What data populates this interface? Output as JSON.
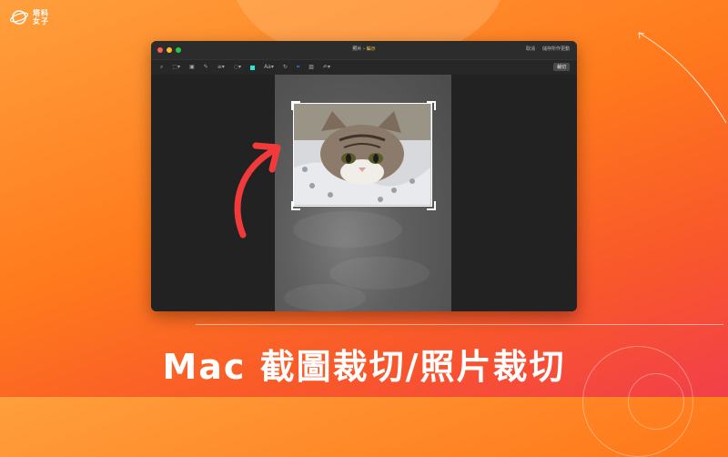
{
  "brand": {
    "line1": "塔科",
    "line2": "女子"
  },
  "window": {
    "title_main": "照片",
    "title_sep": " › ",
    "title_sub": "編示",
    "cancel_label": "取消",
    "save_label": "儲存所作更動",
    "crop_button_label": "裁切",
    "toolbar": [
      {
        "name": "magnifier-icon",
        "glyph": "⌕"
      },
      {
        "name": "shape-select-icon",
        "glyph": "⬚▾"
      },
      {
        "name": "crop-rect-icon",
        "glyph": "▣"
      },
      {
        "name": "pen-icon",
        "glyph": "✎"
      },
      {
        "name": "line-style-icon",
        "glyph": "≡▾"
      },
      {
        "name": "border-style-icon",
        "glyph": "◌▾"
      },
      {
        "name": "font-icon",
        "glyph": "Aa▾"
      },
      {
        "name": "rotate-icon",
        "glyph": "↻"
      },
      {
        "name": "crop-tool-icon",
        "glyph": "⌗"
      },
      {
        "name": "markup-icon",
        "glyph": "▨"
      },
      {
        "name": "sign-icon",
        "glyph": "✍▾"
      }
    ]
  },
  "caption": "Mac 截圖裁切/照片裁切",
  "colors": {
    "accent_arrow": "#f23a3a",
    "crop_tool": "#3d8bff",
    "fill_color": "#2ee6d6"
  }
}
